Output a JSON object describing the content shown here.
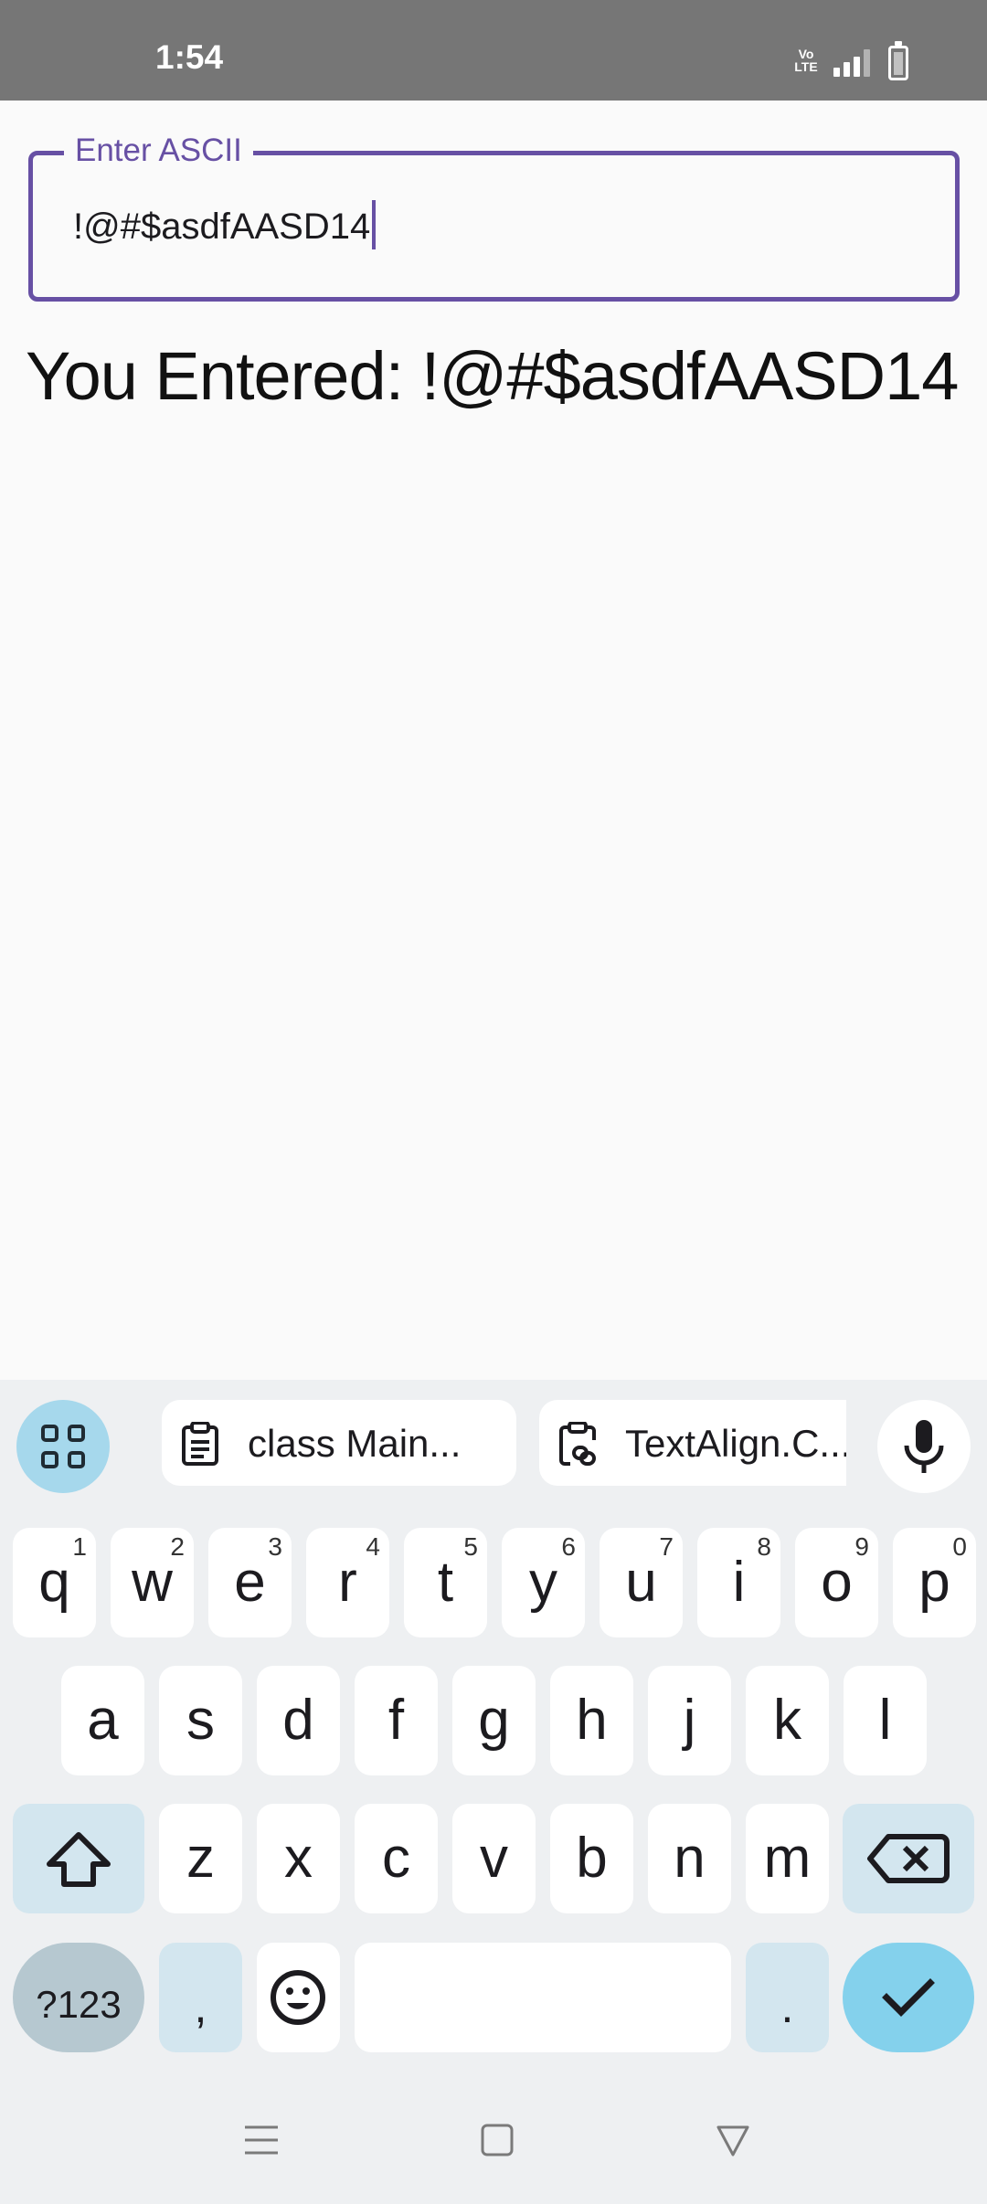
{
  "status_bar": {
    "time": "1:54",
    "volte_icon": "volte-icon",
    "signal_icon": "signal-icon",
    "battery_icon": "battery-charging-icon"
  },
  "input": {
    "label": "Enter ASCII",
    "value": "!@#$asdfAASD14",
    "accent_color": "#6750a4"
  },
  "output": {
    "text": "You Entered: !@#$asdfAASD14"
  },
  "keyboard": {
    "apps_icon": "apps-grid-icon",
    "clipboard_chips": [
      {
        "icon": "clipboard-icon",
        "text": "class Main..."
      },
      {
        "icon": "clipboard-link-icon",
        "text": "TextAlign.C..."
      }
    ],
    "mic_icon": "microphone-icon",
    "row1": [
      {
        "key": "q",
        "hint": "1"
      },
      {
        "key": "w",
        "hint": "2"
      },
      {
        "key": "e",
        "hint": "3"
      },
      {
        "key": "r",
        "hint": "4"
      },
      {
        "key": "t",
        "hint": "5"
      },
      {
        "key": "y",
        "hint": "6"
      },
      {
        "key": "u",
        "hint": "7"
      },
      {
        "key": "i",
        "hint": "8"
      },
      {
        "key": "o",
        "hint": "9"
      },
      {
        "key": "p",
        "hint": "0"
      }
    ],
    "row2": [
      "a",
      "s",
      "d",
      "f",
      "g",
      "h",
      "j",
      "k",
      "l"
    ],
    "row3": [
      "z",
      "x",
      "c",
      "v",
      "b",
      "n",
      "m"
    ],
    "shift_icon": "shift-icon",
    "backspace_icon": "backspace-icon",
    "symbols_label": "?123",
    "comma_label": ",",
    "emoji_icon": "emoji-icon",
    "period_label": ".",
    "enter_icon": "check-icon"
  },
  "nav_bar": {
    "recents_icon": "menu-icon",
    "home_icon": "home-square-icon",
    "back_icon": "back-triangle-icon"
  }
}
